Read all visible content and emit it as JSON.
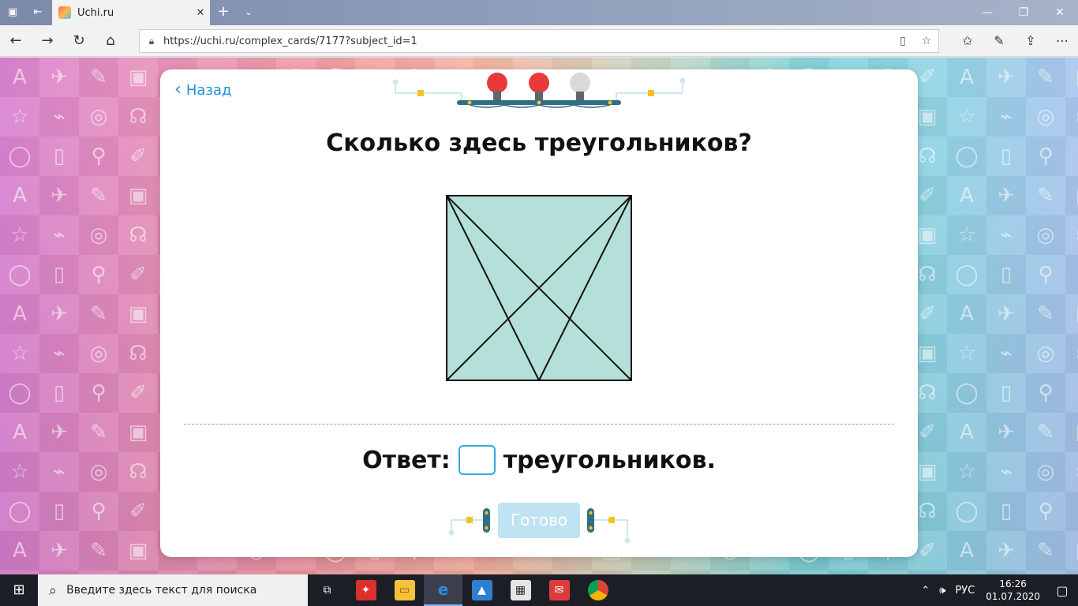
{
  "browser": {
    "tab_title": "Uchi.ru",
    "tab_close": "✕",
    "new_tab": "+",
    "tab_menu": "⌄",
    "url": "https://uchi.ru/complex_cards/7177?subject_id=1",
    "window_controls": {
      "minimize": "—",
      "restore": "❐",
      "close": "✕"
    }
  },
  "card": {
    "back_label": "Назад",
    "question": "Сколько здесь треугольников?",
    "answer_prefix": "Ответ:",
    "answer_suffix": "треугольников.",
    "answer_value": "",
    "ready_label": "Готово",
    "lit_bulbs": 2,
    "total_bulbs": 3
  },
  "colors": {
    "accent": "#1e8fd6",
    "figure_fill": "#b5dfd9",
    "bulb_on": "#e83a3a",
    "bulb_off": "#d9d9d9",
    "ready_bg": "#bfe3f2"
  },
  "taskbar": {
    "search_placeholder": "Введите здесь текст для поиска",
    "language": "РУС",
    "time": "16:26",
    "date": "01.07.2020"
  }
}
